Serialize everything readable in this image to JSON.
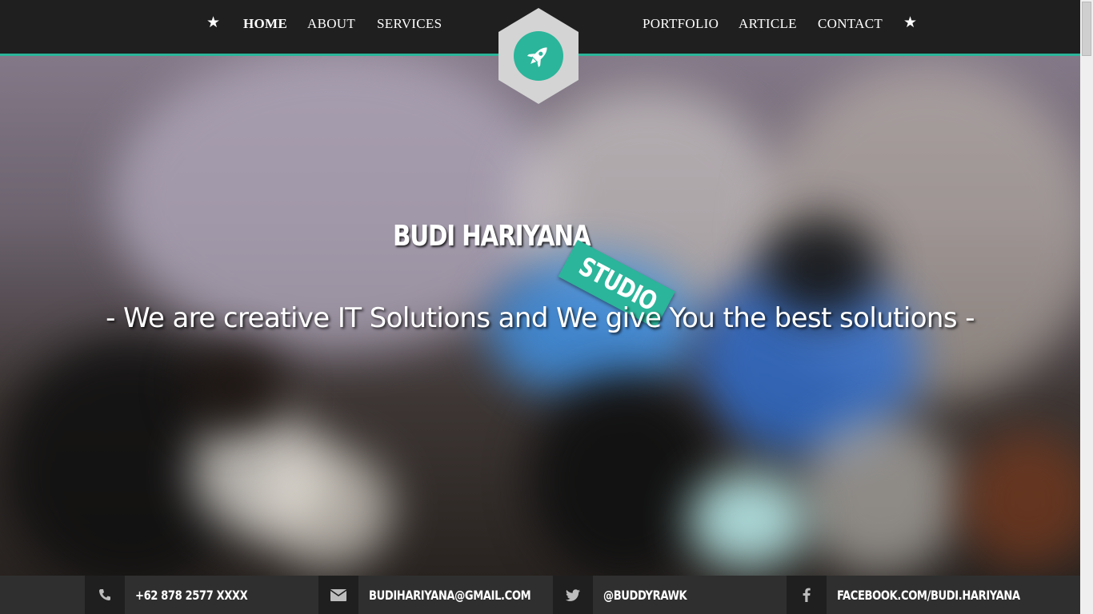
{
  "nav": {
    "left_items": [
      {
        "label": "HOME",
        "active": true
      },
      {
        "label": "ABOUT",
        "active": false
      },
      {
        "label": "SERVICES",
        "active": false
      }
    ],
    "right_items": [
      {
        "label": "PORTFOLIO",
        "active": false
      },
      {
        "label": "ARTICLE",
        "active": false
      },
      {
        "label": "CONTACT",
        "active": false
      }
    ],
    "star_glyph": "★",
    "logo_icon": "rocket-icon"
  },
  "hero": {
    "brand_name": "BUDI HARIYANA",
    "brand_tag": "STUDIO",
    "tagline": "- We are creative IT Solutions and We give You the best solutions -"
  },
  "contact": {
    "phone": {
      "icon": "phone-icon",
      "text": "+62 878 2577 XXXX"
    },
    "email": {
      "icon": "envelope-icon",
      "text": "BUDIHARIYANA@GMAIL.COM"
    },
    "twitter": {
      "icon": "twitter-icon",
      "text": "@BUDDYRAWK"
    },
    "facebook": {
      "icon": "facebook-icon",
      "text": "FACEBOOK.COM/BUDI.HARIYANA"
    }
  },
  "colors": {
    "accent": "#2bb59a",
    "navbar_bg": "#1f1f1f",
    "contact_bar_bg": "#2f2f2f",
    "logo_hex": "#d4d4d4"
  }
}
